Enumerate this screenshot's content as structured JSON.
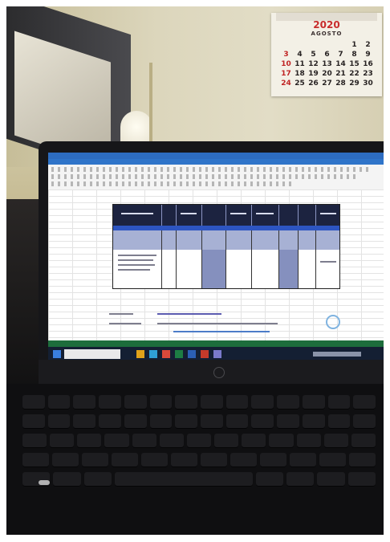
{
  "calendar": {
    "year": "2020",
    "month": "AGOSTO",
    "days": [
      "",
      "",
      "",
      "",
      "",
      "1",
      "2",
      "3",
      "4",
      "5",
      "6",
      "7",
      "8",
      "9",
      "10",
      "11",
      "12",
      "13",
      "14",
      "15",
      "16",
      "17",
      "18",
      "19",
      "20",
      "21",
      "22",
      "23",
      "24",
      "25",
      "26",
      "27",
      "28",
      "29",
      "30"
    ]
  },
  "colors": {
    "calendar_red": "#c82c2c",
    "table_header": "#1c2340",
    "table_band": "#2d55c2",
    "table_row_shade": "#a7b1d4",
    "excel_status": "#1d6d3c",
    "taskbar": "#141f33"
  },
  "icons": [
    "windows-start-icon",
    "taskbar-search-box",
    "hp-logo-icon"
  ]
}
